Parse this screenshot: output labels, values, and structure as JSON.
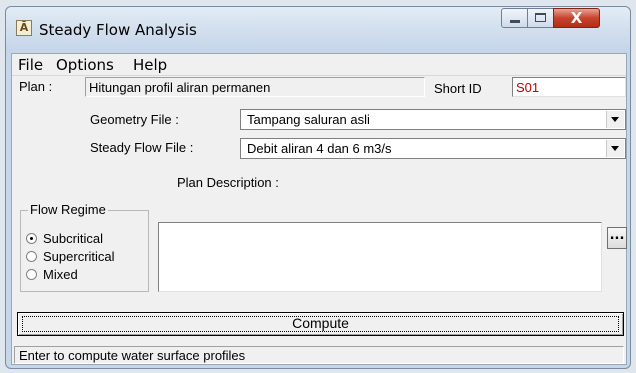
{
  "window": {
    "title": "Steady Flow Analysis",
    "icon": "hec-ras-app-icon",
    "controls": {
      "minimize": "minimize-icon",
      "maximize": "maximize-icon",
      "close": "close-icon",
      "close_glyph": "X"
    }
  },
  "menu": {
    "items": [
      "File",
      "Options",
      "Help"
    ]
  },
  "plan": {
    "label": "Plan :",
    "value": "Hitungan profil aliran permanen",
    "short_id_label": "Short ID",
    "short_id_value": "S01"
  },
  "geometry_file": {
    "label": "Geometry File :",
    "value": "Tampang saluran asli"
  },
  "steady_flow_file": {
    "label": "Steady Flow File :",
    "value": "Debit aliran 4 dan 6 m3/s"
  },
  "flow_regime": {
    "title": "Flow Regime",
    "options": [
      "Subcritical",
      "Supercritical",
      "Mixed"
    ],
    "selected": "Subcritical"
  },
  "plan_description": {
    "label": "Plan Description :",
    "value": "",
    "browse_label": "..."
  },
  "compute_button": {
    "label": "Compute"
  },
  "status": {
    "text": "Enter to compute water surface profiles"
  },
  "colors": {
    "short_id_text": "#c00000",
    "close_button": "#c7432c"
  }
}
